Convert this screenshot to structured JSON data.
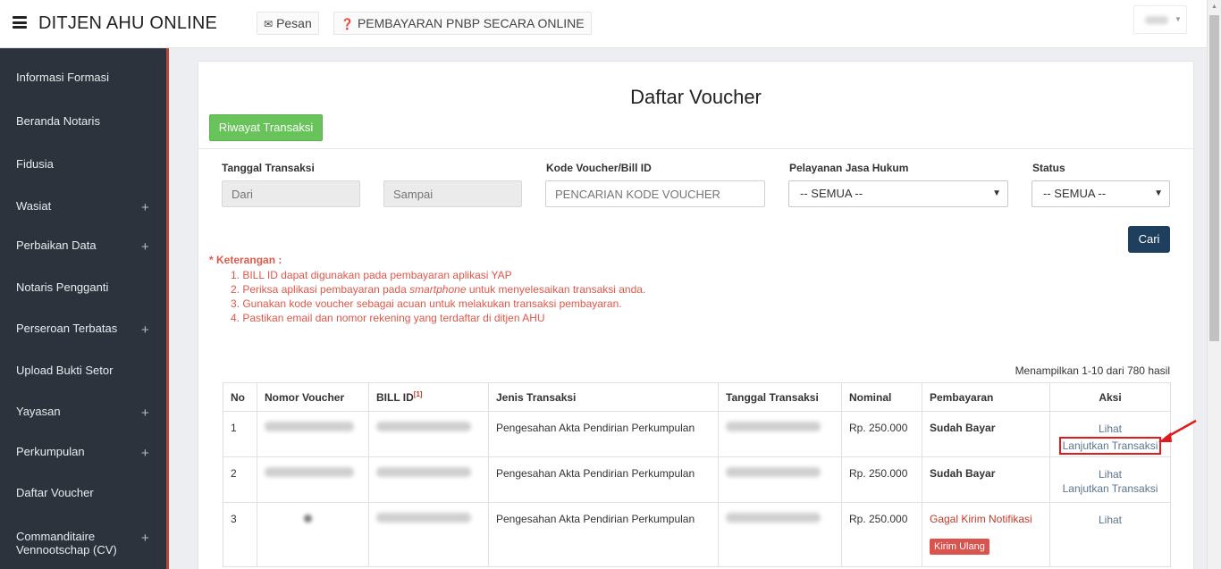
{
  "header": {
    "brand": "DITJEN AHU ONLINE",
    "pesan_label": "Pesan",
    "pembayaran_label": "PEMBAYARAN PNBP SECARA ONLINE"
  },
  "sidebar": {
    "items": [
      {
        "label": "Informasi Formasi",
        "plus": ""
      },
      {
        "label": "Beranda Notaris",
        "plus": ""
      },
      {
        "label": "Fidusia",
        "plus": ""
      },
      {
        "label": "Wasiat",
        "plus": "+"
      },
      {
        "label": "Perbaikan Data",
        "plus": "+"
      },
      {
        "label": "Notaris Pengganti",
        "plus": ""
      },
      {
        "label": "Perseroan Terbatas",
        "plus": "+"
      },
      {
        "label": "Upload Bukti Setor",
        "plus": ""
      },
      {
        "label": "Yayasan",
        "plus": "+"
      },
      {
        "label": "Perkumpulan",
        "plus": "+"
      },
      {
        "label": "Daftar Voucher",
        "plus": ""
      },
      {
        "label": "Commanditaire Vennootschap (CV)",
        "plus": "+"
      }
    ]
  },
  "main": {
    "title": "Daftar Voucher",
    "riwayat_button": "Riwayat Transaksi",
    "filters": {
      "tanggal_label": "Tanggal Transaksi",
      "dari_placeholder": "Dari",
      "sampai_placeholder": "Sampai",
      "kode_label": "Kode Voucher/Bill ID",
      "kode_placeholder": "PENCARIAN KODE VOUCHER",
      "pelayanan_label": "Pelayanan Jasa Hukum",
      "pelayanan_value": "-- SEMUA --",
      "status_label": "Status",
      "status_value": "-- SEMUA --",
      "cari_button": "Cari"
    },
    "notes": {
      "title": "* Keterangan :",
      "item1": "1. BILL ID dapat digunakan pada pembayaran aplikasi YAP",
      "item2_pre": "2. Periksa aplikasi pembayaran pada ",
      "item2_em": "smartphone",
      "item2_post": " untuk menyelesaikan transaksi anda.",
      "item3": "3. Gunakan kode voucher sebagai acuan untuk melakukan transaksi pembayaran.",
      "item4": "4. Pastikan email dan nomor rekening yang terdaftar di ditjen AHU"
    },
    "result_count": "Menampilkan 1-10 dari 780 hasil",
    "table": {
      "headers": {
        "no": "No",
        "nomor": "Nomor Voucher",
        "bill": "BILL ID",
        "bill_sup": "[1]",
        "jenis": "Jenis Transaksi",
        "tanggal": "Tanggal Transaksi",
        "nominal": "Nominal",
        "pembayaran": "Pembayaran",
        "aksi": "Aksi"
      },
      "rows": [
        {
          "no": "1",
          "jenis": "Pengesahan Akta Pendirian Perkumpulan",
          "nominal": "Rp. 250.000",
          "pembayaran": "Sudah Bayar",
          "lihat": "Lihat",
          "lanjutkan": "Lanjutkan Transaksi"
        },
        {
          "no": "2",
          "jenis": "Pengesahan Akta Pendirian Perkumpulan",
          "nominal": "Rp. 250.000",
          "pembayaran": "Sudah Bayar",
          "lihat": "Lihat",
          "lanjutkan": "Lanjutkan Transaksi"
        },
        {
          "no": "3",
          "jenis": "Pengesahan Akta Pendirian Perkumpulan",
          "nominal": "Rp. 250.000",
          "pembayaran": "Gagal Kirim Notifikasi",
          "kirim_ulang": "Kirim Ulang",
          "lihat": "Lihat"
        }
      ]
    }
  },
  "colors": {
    "sidebar_bg": "#2c333c",
    "sidebar_accent": "#b9453a",
    "green_button": "#69c35b",
    "cari_button": "#1f3f5e",
    "note_red": "#e0574a",
    "paid_green": "#2e9a3a",
    "fail_red": "#c0392b"
  },
  "icons": {
    "menu": "hamburger-icon",
    "pesan": "envelope-icon",
    "pembayaran": "question-circle-icon"
  }
}
